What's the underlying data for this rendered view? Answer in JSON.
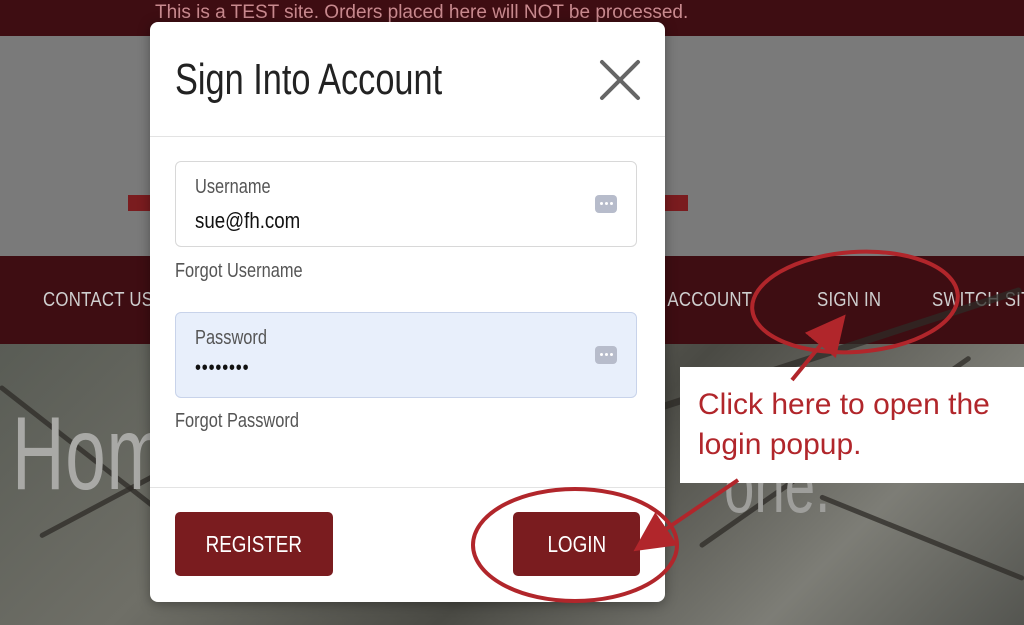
{
  "banner": {
    "text": "This is a TEST site. Orders placed here will NOT be processed."
  },
  "nav": {
    "items": [
      {
        "label": "CONTACT US"
      },
      {
        "label": "CREATE ACCOUNT"
      },
      {
        "label": "SIGN IN"
      },
      {
        "label": "SWITCH SITE"
      }
    ]
  },
  "hero": {
    "title": "Hom",
    "title_end": "one."
  },
  "modal": {
    "title": "Sign Into Account",
    "username": {
      "label": "Username",
      "value": "sue@fh.com"
    },
    "forgot_username": "Forgot Username",
    "password": {
      "label": "Password",
      "value": "••••••••"
    },
    "forgot_password": "Forgot Password",
    "register_label": "REGISTER",
    "login_label": "LOGIN"
  },
  "annotation": {
    "callout_text": "Click here to open the login popup.",
    "color": "#b1262b"
  },
  "colors": {
    "brand": "#7a1c1f",
    "nav_bg": "#3e0d12"
  }
}
